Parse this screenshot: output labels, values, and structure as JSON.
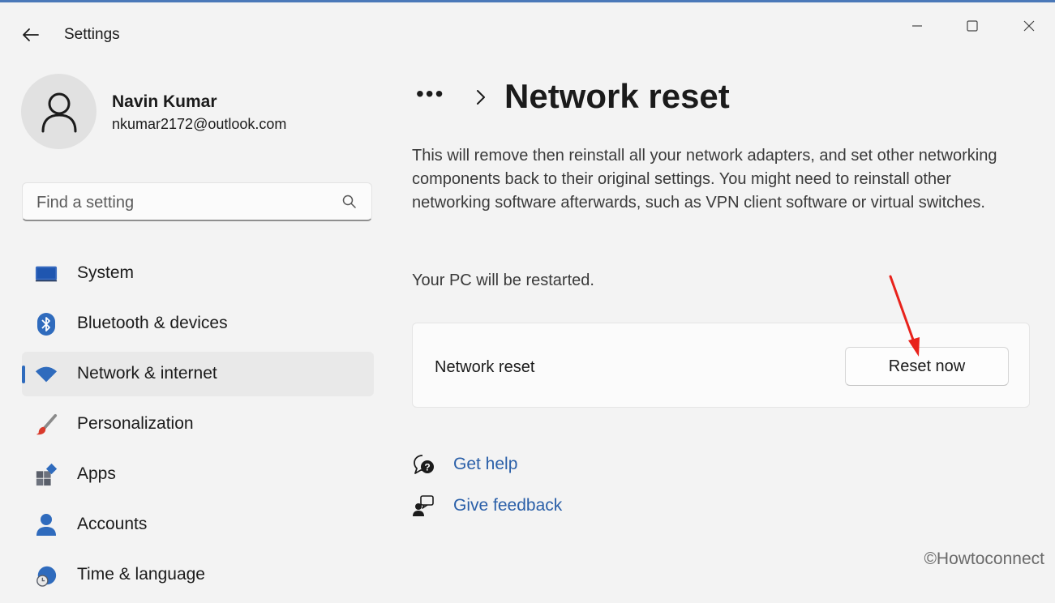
{
  "window": {
    "app_title": "Settings",
    "accent_color": "#2f6bbd"
  },
  "profile": {
    "name": "Navin Kumar",
    "email": "nkumar2172@outlook.com"
  },
  "search": {
    "placeholder": "Find a setting"
  },
  "sidebar": {
    "items": [
      {
        "label": "System",
        "icon": "monitor-icon",
        "selected": false
      },
      {
        "label": "Bluetooth & devices",
        "icon": "bluetooth-icon",
        "selected": false
      },
      {
        "label": "Network & internet",
        "icon": "wifi-icon",
        "selected": true
      },
      {
        "label": "Personalization",
        "icon": "brush-icon",
        "selected": false
      },
      {
        "label": "Apps",
        "icon": "apps-icon",
        "selected": false
      },
      {
        "label": "Accounts",
        "icon": "person-icon",
        "selected": false
      },
      {
        "label": "Time & language",
        "icon": "clock-icon",
        "selected": false
      }
    ]
  },
  "main": {
    "breadcrumb_more": "•••",
    "title": "Network reset",
    "description": "This will remove then reinstall all your network adapters, and set other networking components back to their original settings. You might need to reinstall other networking software afterwards, such as VPN client software or virtual switches.",
    "restart_note": "Your PC will be restarted.",
    "card": {
      "label": "Network reset",
      "button_label": "Reset now"
    },
    "links": {
      "get_help": "Get help",
      "give_feedback": "Give feedback"
    },
    "link_color": "#2a5fa8"
  },
  "annotation": {
    "arrow_color": "#e8221b"
  },
  "watermark": "©Howtoconnect"
}
